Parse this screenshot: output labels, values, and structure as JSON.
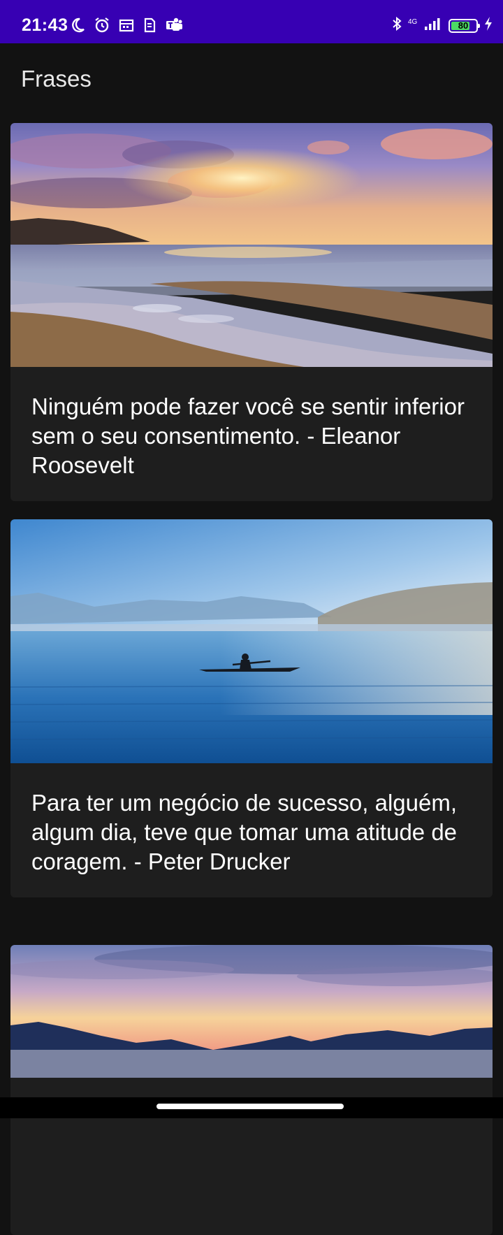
{
  "status_bar": {
    "time": "21:43",
    "network_label": "4G",
    "network_sub": "4G",
    "battery_level": 80,
    "battery_text": "80",
    "icons": [
      "moon-icon",
      "alarm-icon",
      "calendar-icon",
      "sim-icon",
      "teams-icon",
      "bluetooth-icon",
      "signal-icon",
      "battery-icon",
      "charging-icon"
    ]
  },
  "header": {
    "title": "Frases"
  },
  "cards": [
    {
      "quote": "Ninguém pode fazer você se sentir inferior sem o seu consentimento. - Eleanor Roosevelt",
      "image": "beach-sunset-image"
    },
    {
      "quote": "Para ter um negócio de sucesso, alguém, algum dia, teve que tomar uma atitude de coragem. - Peter Drucker",
      "image": "lake-kayak-image"
    },
    {
      "quote": "",
      "image": "mountain-sunrise-image"
    }
  ],
  "colors": {
    "status_bar": "#3700b3",
    "background": "#121212",
    "card": "#1e1e1e",
    "battery_fill": "#4cd964"
  }
}
